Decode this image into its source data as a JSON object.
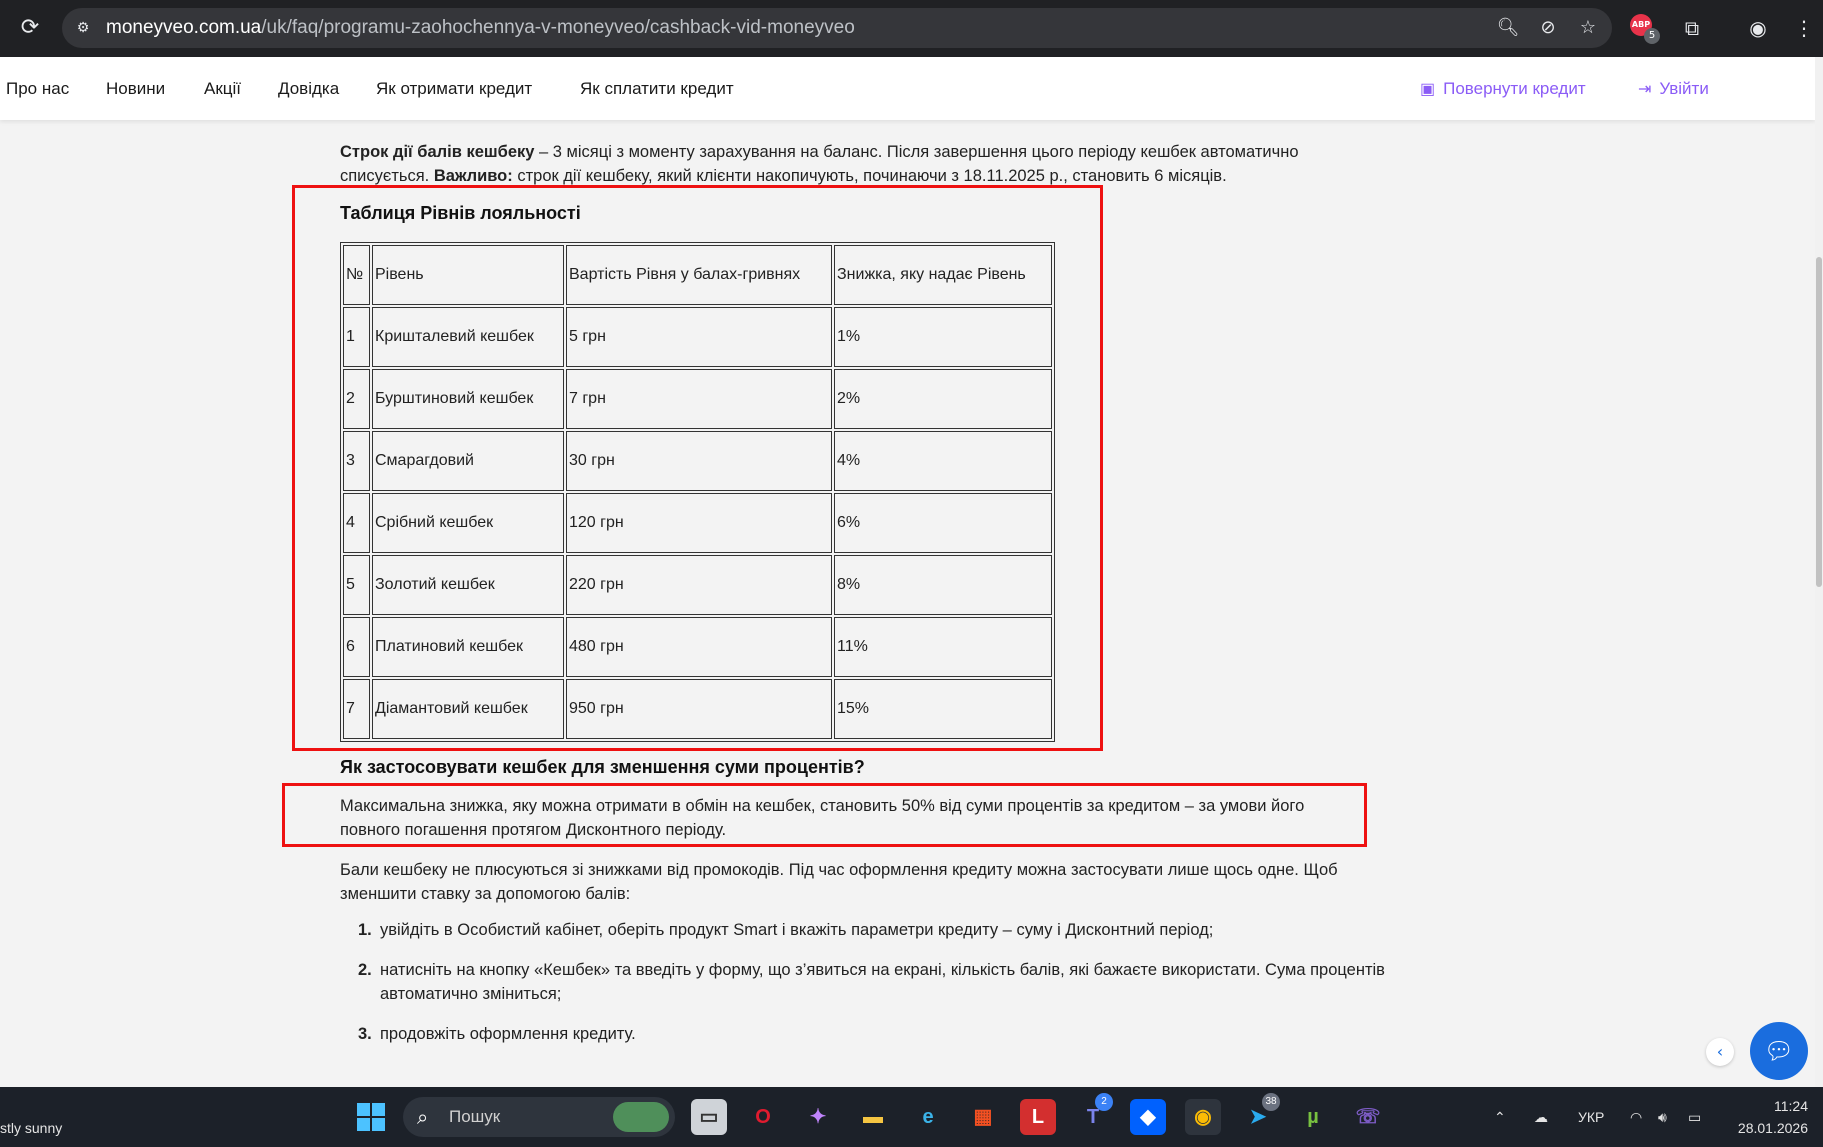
{
  "browser": {
    "url_host": "moneyveo.com.ua",
    "url_path": "/uk/faq/programu-zaohochennya-v-moneyveo/cashback-vid-moneyveo",
    "ext_badge_count": "5",
    "ext_badge_text": "ABP"
  },
  "nav": {
    "items": [
      "Про нас",
      "Новини",
      "Акції",
      "Довідка",
      "Як отримати кредит",
      "Як сплатити кредит"
    ],
    "repay_label": "Повернути кредит",
    "login_label": "Увійти",
    "accent_color": "#8b5cf6"
  },
  "content": {
    "p1_bold": "Строк дії балів кешбеку",
    "p1_text": " – 3 місяці з моменту зарахування на баланс. Після завершення цього періоду кешбек автоматично списується. ",
    "p1_bold2": "Важливо:",
    "p1_text2": " строк дії кешбеку, який клієнти накопичують, починаючи з 18.11.2025 р., становить 6 місяців.",
    "table_title": "Таблиця Рівнів лояльності",
    "table_headers": [
      "№",
      "Рівень",
      "Вартість Рівня у балах-гривнях",
      "Знижка, яку надає Рівень"
    ],
    "table_rows": [
      [
        "1",
        "Кришталевий кешбек",
        "5 грн",
        "1%"
      ],
      [
        "2",
        "Бурштиновий кешбек",
        "7 грн",
        "2%"
      ],
      [
        "3",
        "Смарагдовий",
        "30 грн",
        "4%"
      ],
      [
        "4",
        "Срібний кешбек",
        "120 грн",
        "6%"
      ],
      [
        "5",
        "Золотий кешбек",
        "220 грн",
        "8%"
      ],
      [
        "6",
        "Платиновий кешбек",
        "480 грн",
        "11%"
      ],
      [
        "7",
        "Діамантовий кешбек",
        "950 грн",
        "15%"
      ]
    ],
    "h2": "Як застосовувати кешбек для зменшення суми процентів?",
    "p2": "Максимальна знижка, яку можна отримати в обмін на кешбек, становить 50% від суми процентів за кредитом – за умови його повного погашення протягом Дисконтного періоду.",
    "p3": "Бали кешбеку не плюсуються зі знижками від промокодів. Під час оформлення кредиту можна застосувати лише щось одне. Щоб зменшити ставку за допомогою балів:",
    "steps": [
      {
        "num": "1.",
        "text": "увійдіть в Особистий кабінет, оберіть продукт Smart і вкажіть параметри кредиту – суму і Дисконтний період;"
      },
      {
        "num": "2.",
        "text": "натисніть на кнопку «Кешбек» та введіть у форму, що з’явиться на екрані, кількість балів, які бажаєте використати. Сума процентів автоматично зміниться;"
      },
      {
        "num": "3.",
        "text": "продовжіть оформлення кредиту."
      }
    ]
  },
  "taskbar": {
    "weather": "stly sunny",
    "search_label": "Пошук",
    "teams_badge": "2",
    "telegram_badge": "38",
    "lang": "УКР",
    "time": "11:24",
    "date": "28.01.2026"
  },
  "colors": {
    "highlight_box": "#ee1111",
    "chat_button": "#1a6dde"
  }
}
